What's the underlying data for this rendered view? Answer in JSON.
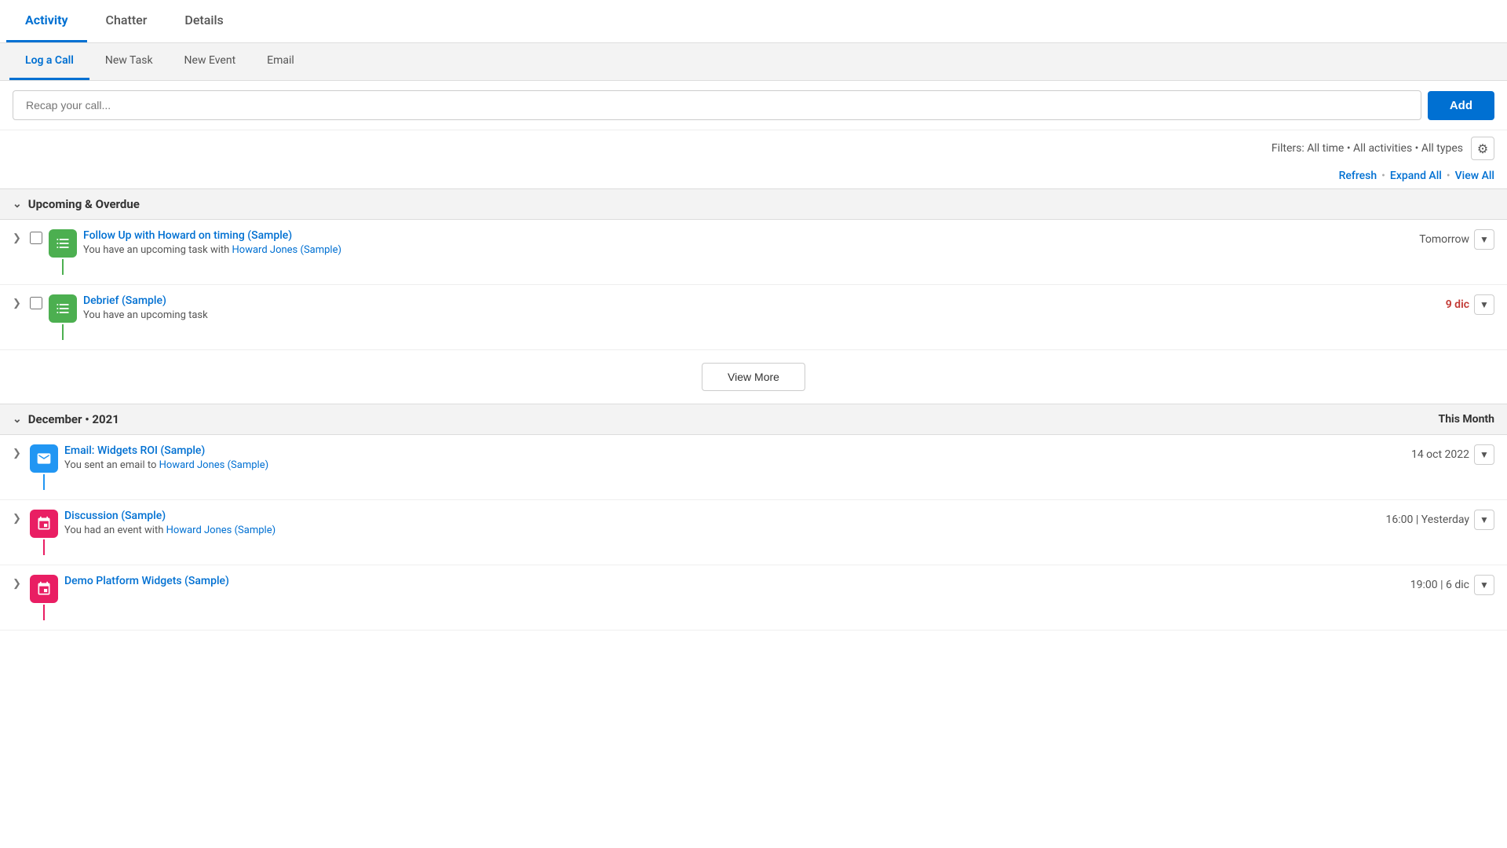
{
  "tabs": {
    "top": [
      {
        "label": "Activity",
        "active": true
      },
      {
        "label": "Chatter",
        "active": false
      },
      {
        "label": "Details",
        "active": false
      }
    ],
    "sub": [
      {
        "label": "Log a Call",
        "active": true
      },
      {
        "label": "New Task",
        "active": false
      },
      {
        "label": "New Event",
        "active": false
      },
      {
        "label": "Email",
        "active": false
      }
    ]
  },
  "input": {
    "placeholder": "Recap your call...",
    "add_button": "Add"
  },
  "filters": {
    "text": "Filters: All time • All activities • All types"
  },
  "actions": {
    "refresh": "Refresh",
    "expand_all": "Expand All",
    "view_all": "View All"
  },
  "sections": [
    {
      "id": "upcoming",
      "title": "Upcoming & Overdue",
      "items": [
        {
          "type": "task",
          "title": "Follow Up with Howard on timing (Sample)",
          "description": "You have an upcoming task with",
          "link_text": "Howard Jones (Sample)",
          "date": "Tomorrow",
          "overdue": false
        },
        {
          "type": "task",
          "title": "Debrief (Sample)",
          "description": "You have an upcoming task",
          "link_text": "",
          "date": "9 dic",
          "overdue": true
        }
      ],
      "view_more": "View More"
    },
    {
      "id": "december2021",
      "title": "December • 2021",
      "badge": "This Month",
      "items": [
        {
          "type": "email",
          "title": "Email: Widgets ROI (Sample)",
          "description": "You sent an email to",
          "link_text": "Howard Jones (Sample)",
          "date": "14 oct 2022",
          "overdue": false
        },
        {
          "type": "event",
          "title": "Discussion (Sample)",
          "description": "You had an event with",
          "link_text": "Howard Jones (Sample)",
          "date": "16:00 | Yesterday",
          "overdue": false
        },
        {
          "type": "event",
          "title": "Demo Platform Widgets (Sample)",
          "description": "",
          "link_text": "",
          "date": "19:00 | 6 dic",
          "overdue": false
        }
      ]
    }
  ]
}
